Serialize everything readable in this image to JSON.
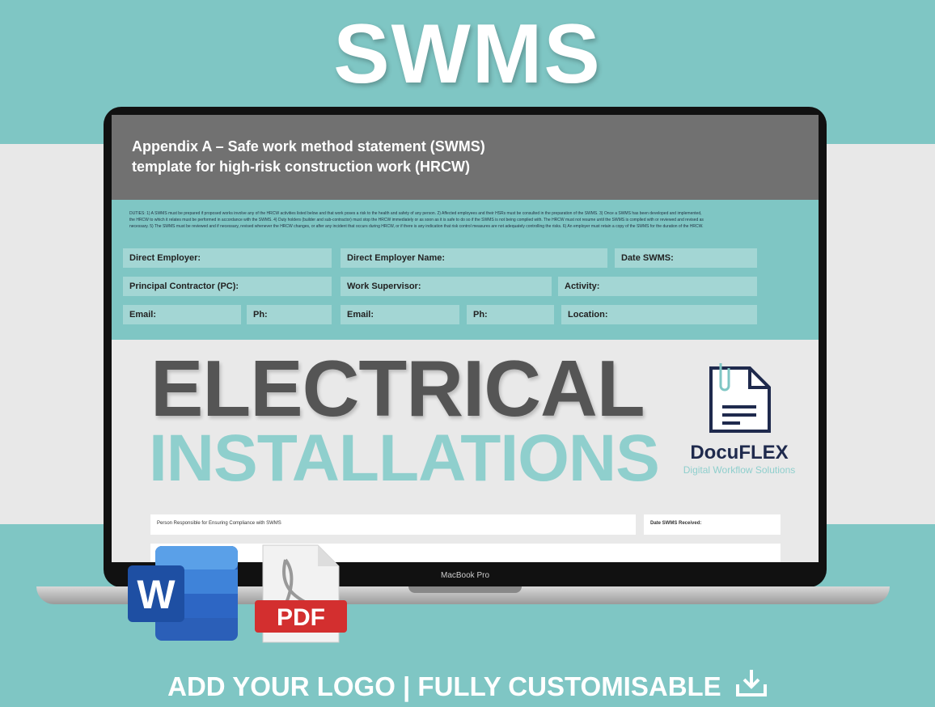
{
  "title": "SWMS",
  "document": {
    "heading_line1": "Appendix A – Safe work method statement (SWMS)",
    "heading_line2": "template for high-risk construction work (HRCW)",
    "duties": "DUTIES: 1) A SWMS must be prepared if proposed works involve any of the HRCW activities listed below and that work poses a risk to the health and safety of any person. 2) Affected employees and their HSRs must be consulted in the preparation of the SWMS. 3) Once a SWMS has been developed and implemented, the HRCW to which it relates must be performed in accordance with the SWMS. 4) Duty holders (builder and sub-contractor) must stop the HRCW immediately or as soon as it is safe to do so if the SWMS is not being complied with. The HRCW must not resume until the SWMS is complied with or reviewed and revised as necessary. 5) The SWMS must be reviewed and if necessary, revised whenever the HRCW changes, or after any incident that occurs during HRCW, or if there is any indication that risk control measures are not adequately controlling the risks. 6) An employer must retain a copy of the SWMS for the duration of the HRCW.",
    "fields": [
      "Direct Employer:",
      "Direct Employer Name:",
      "Date SWMS:",
      "Principal Contractor (PC):",
      "Work Supervisor:",
      "Activity:",
      "Email:",
      "Ph:",
      "Email:",
      "Ph:",
      "Location:"
    ],
    "person_responsible": "Person Responsible for Ensuring Compliance with SWMS",
    "date_received": "Date SWMS Received:"
  },
  "overlay": {
    "line1": "ELECTRICAL",
    "line2": "INSTALLATIONS"
  },
  "brand": {
    "name": "DocuFLEX",
    "tagline": "Digital Workflow Solutions"
  },
  "device_label": "MacBook Pro",
  "icons": {
    "word_letter": "W",
    "pdf_label": "PDF"
  },
  "footer": "ADD YOUR LOGO | FULLY CUSTOMISABLE",
  "colors": {
    "teal": "#7fc6c4",
    "grey_header": "#717171",
    "navy": "#1f2a4d"
  }
}
